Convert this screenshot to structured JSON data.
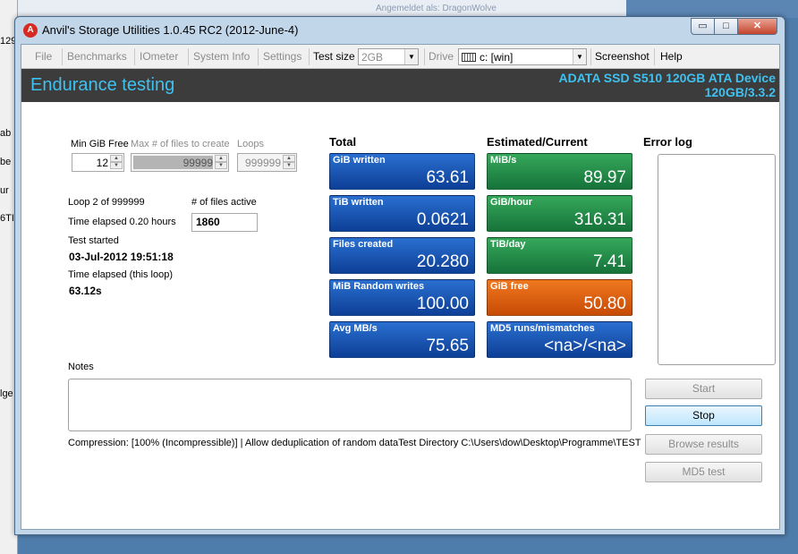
{
  "background": {
    "left_fragments": [
      "129",
      "ab",
      "be",
      "ur",
      "6TI",
      "lge"
    ],
    "top_text": "Angemeldet als: DragonWolve"
  },
  "window": {
    "title": "Anvil's Storage Utilities 1.0.45 RC2 (2012-June-4)",
    "controls": {
      "minimize": "▭",
      "maximize": "□",
      "close": "✕"
    }
  },
  "menu": {
    "file": "File",
    "benchmarks": "Benchmarks",
    "iometer": "IOmeter",
    "system_info": "System Info",
    "settings": "Settings",
    "test_size_label": "Test size",
    "test_size_value": "2GB",
    "drive_label": "Drive",
    "drive_value": "c: [win]",
    "screenshot": "Screenshot",
    "help": "Help"
  },
  "header": {
    "title": "Endurance testing",
    "device": "ADATA SSD S510 120GB ATA Device",
    "firmware": "120GB/3.3.2"
  },
  "params": {
    "min_gib_free_label": "Min GiB Free",
    "min_gib_free_value": "12",
    "max_files_label": "Max # of files to create",
    "max_files_value": "99999",
    "loops_label": "Loops",
    "loops_value": "999999"
  },
  "status": {
    "loop": "Loop 2 of 999999",
    "time_elapsed": "Time elapsed 0.20 hours",
    "test_started_label": "Test started",
    "test_started_value": "03-Jul-2012 19:51:18",
    "time_elapsed_loop_label": "Time elapsed (this loop)",
    "time_elapsed_loop_value": "63.12s",
    "files_active_label": "# of files active",
    "files_active_value": "1860"
  },
  "total": {
    "heading": "Total",
    "tiles": [
      {
        "label": "GiB written",
        "value": "63.61"
      },
      {
        "label": "TiB written",
        "value": "0.0621"
      },
      {
        "label": "Files created",
        "value": "20.280"
      },
      {
        "label": "MiB Random writes",
        "value": "100.00"
      },
      {
        "label": "Avg MB/s",
        "value": "75.65"
      }
    ]
  },
  "estimated": {
    "heading": "Estimated/Current",
    "tiles": [
      {
        "label": "MiB/s",
        "value": "89.97"
      },
      {
        "label": "GiB/hour",
        "value": "316.31"
      },
      {
        "label": "TiB/day",
        "value": "7.41"
      },
      {
        "label": "GiB free",
        "value": "50.80"
      },
      {
        "label": "MD5 runs/mismatches",
        "value": "<na>/<na>"
      }
    ]
  },
  "error_log": {
    "heading": "Error log"
  },
  "notes": {
    "label": "Notes"
  },
  "buttons": {
    "start": "Start",
    "stop": "Stop",
    "browse": "Browse results",
    "md5": "MD5 test"
  },
  "footer": {
    "compression": "Compression: [100% (Incompressible)] | Allow deduplication of random dataTest Directory C:\\Users\\dow\\Desktop\\Programme\\TEST"
  },
  "colors": {
    "accent_text": "#3fc1f0",
    "tile_blue": "#1a55b8",
    "tile_green": "#22894a",
    "tile_orange": "#e25f10"
  }
}
